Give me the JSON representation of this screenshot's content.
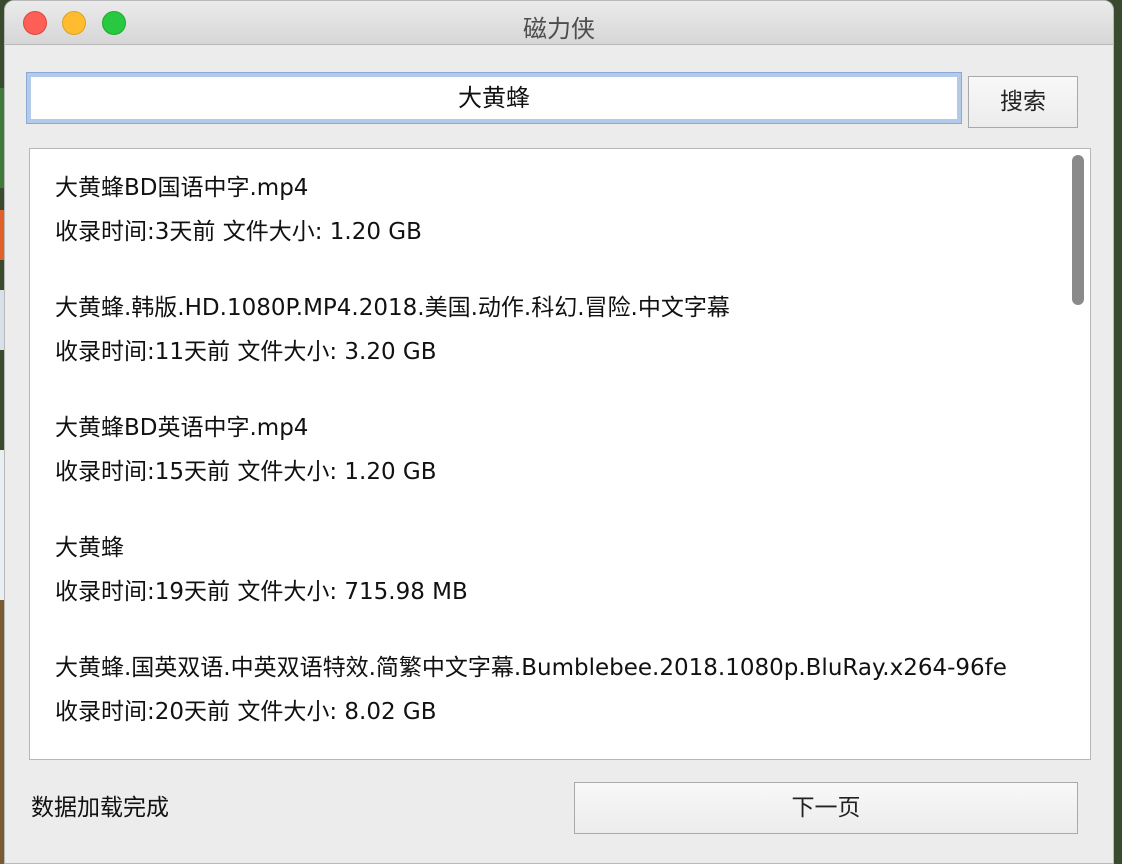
{
  "window": {
    "title": "磁力侠"
  },
  "search": {
    "value": "大黄蜂",
    "button_label": "搜索"
  },
  "results": [
    {
      "name": "大黄蜂BD国语中字.mp4",
      "meta": "收录时间:3天前   文件大小: 1.20 GB"
    },
    {
      "name": "大黄蜂.韩版.HD.1080P.MP4.2018.美国.动作.科幻.冒险.中文字幕",
      "meta": "收录时间:11天前   文件大小: 3.20 GB"
    },
    {
      "name": "大黄蜂BD英语中字.mp4",
      "meta": "收录时间:15天前   文件大小: 1.20 GB"
    },
    {
      "name": "大黄蜂",
      "meta": "收录时间:19天前   文件大小: 715.98 MB"
    },
    {
      "name": "大黄蜂.国英双语.中英双语特效.简繁中文字幕.Bumblebee.2018.1080p.BluRay.x264-96fe",
      "meta": "收录时间:20天前   文件大小: 8.02 GB"
    }
  ],
  "footer": {
    "status": "数据加载完成",
    "next_label": "下一页"
  }
}
